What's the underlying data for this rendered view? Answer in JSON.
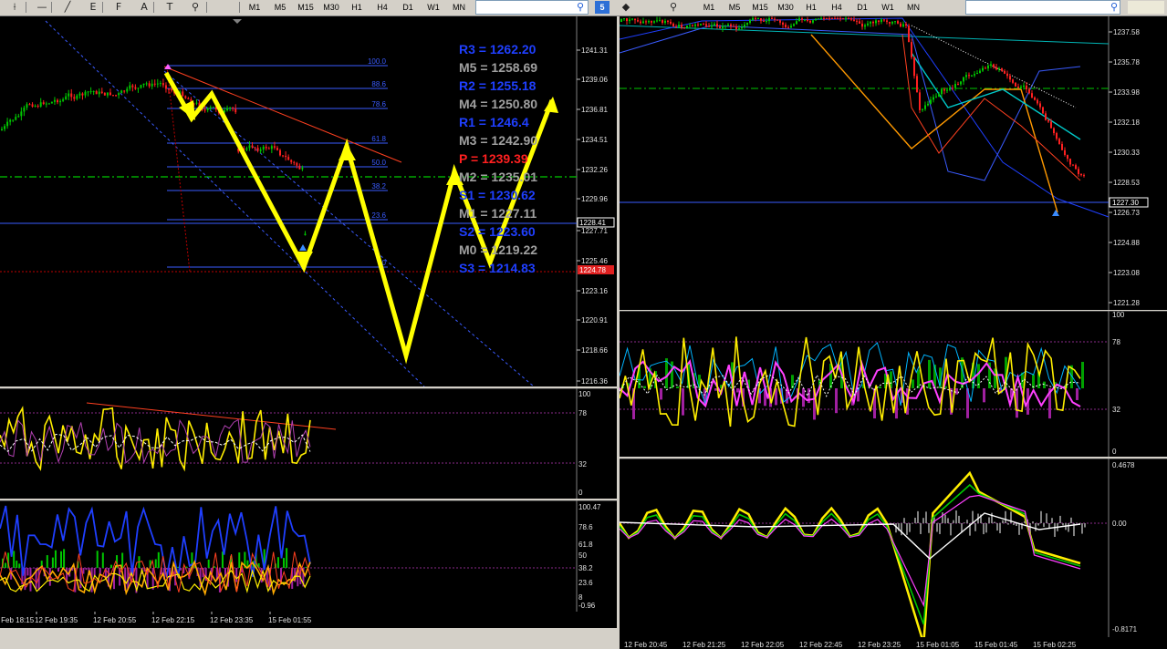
{
  "left_toolbar": {
    "timeframes": [
      "M1",
      "M5",
      "M15",
      "M30",
      "H1",
      "H4",
      "D1",
      "W1",
      "MN"
    ],
    "badge": "5",
    "icons": [
      "cursor-icon",
      "horizontal-line-icon",
      "trendline-icon",
      "fibonacci-icon",
      "text-label-icon",
      "arrow-label-icon",
      "period-icon"
    ],
    "icon_glyphs": [
      "⟊",
      "—",
      "╱",
      "E",
      "F",
      "A",
      "T",
      "⚲"
    ]
  },
  "right_toolbar": {
    "timeframes": [
      "M1",
      "M5",
      "M15",
      "M30",
      "H1",
      "H4",
      "D1",
      "W1",
      "MN"
    ]
  },
  "left_price_axis": [
    "1241.31",
    "1239.06",
    "1236.81",
    "1234.51",
    "1232.26",
    "1229.96",
    "1228.41",
    "1227.71",
    "1225.46",
    "1223.16",
    "1220.91",
    "1218.66",
    "1216.36"
  ],
  "left_price_tag": "1224.78",
  "left_current_price": "1228.41",
  "fib_levels": [
    "100.0",
    "88.6",
    "78.6",
    "61.8",
    "50.0",
    "38.2",
    "23.6",
    "0"
  ],
  "pivots": [
    {
      "label": "R3 = 1262.20",
      "color": "#1f3fff"
    },
    {
      "label": "M5 = 1258.69",
      "color": "#a0a0a0"
    },
    {
      "label": "R2 = 1255.18",
      "color": "#1f3fff"
    },
    {
      "label": "M4 = 1250.80",
      "color": "#a0a0a0"
    },
    {
      "label": "R1 = 1246.4",
      "color": "#1f3fff"
    },
    {
      "label": "M3 = 1242.90",
      "color": "#a0a0a0"
    },
    {
      "label": "P   = 1239.39",
      "color": "#ff2020"
    },
    {
      "label": "M2 = 1235.01",
      "color": "#a0a0a0"
    },
    {
      "label": "S1 = 1230.62",
      "color": "#1f3fff"
    },
    {
      "label": "M1 = 1227.11",
      "color": "#a0a0a0"
    },
    {
      "label": "S2 = 1223.60",
      "color": "#1f3fff"
    },
    {
      "label": "M0 = 1219.22",
      "color": "#a0a0a0"
    },
    {
      "label": "S3 = 1214.83",
      "color": "#1f3fff"
    }
  ],
  "left_osc1_axis": [
    "100",
    "78",
    "32",
    "0"
  ],
  "left_osc2_axis": [
    "100.47",
    "78.6",
    "61.8",
    "50",
    "38.2",
    "23.6",
    "8",
    "-0.96"
  ],
  "left_time_axis": [
    "12 Feb 18:15",
    "12 Feb 19:35",
    "12 Feb 20:55",
    "12 Feb 22:15",
    "12 Feb 23:35",
    "15 Feb 01:55"
  ],
  "right_price_axis": [
    "1237.58",
    "1235.78",
    "1233.98",
    "1232.18",
    "1230.33",
    "1228.53",
    "1226.73",
    "1224.88",
    "1223.08",
    "1221.28"
  ],
  "right_price_tag": "1227.30",
  "right_osc1_axis": [
    "100",
    "78",
    "32",
    "0"
  ],
  "right_osc2_axis": [
    "0.4678",
    "0.00",
    "-0.8171"
  ],
  "right_time_axis": [
    "12 Feb 20:45",
    "12 Feb 21:25",
    "12 Feb 22:05",
    "12 Feb 22:45",
    "12 Feb 23:25",
    "15 Feb 01:05",
    "15 Feb 01:45",
    "15 Feb 02:25"
  ],
  "colors": {
    "background": "#000000",
    "bull_candle": "#00c800",
    "bear_candle": "#ff2020",
    "annotation_arrow": "#ffff00",
    "pivot_blue": "#1f3fff",
    "pivot_red": "#ff2020",
    "pivot_grey": "#a0a0a0",
    "grid_line": "#3a5bff"
  }
}
